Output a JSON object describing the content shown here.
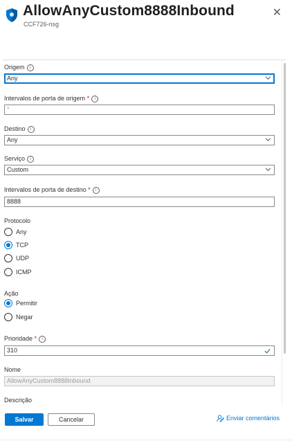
{
  "header": {
    "title": "AllowAnyCustom8888Inbound",
    "subtitle": "CCF726-nsg",
    "close_icon": "close-icon"
  },
  "form": {
    "origem": {
      "label": "Origem",
      "value": "Any"
    },
    "src_ports": {
      "label": "Intervalos de porta de origem",
      "required": "*",
      "value": "*"
    },
    "destino": {
      "label": "Destino",
      "value": "Any"
    },
    "servico": {
      "label": "Serviço",
      "value": "Custom"
    },
    "dst_ports": {
      "label": "Intervalos de porta de destino",
      "required": "*",
      "value": "8888"
    },
    "protocolo": {
      "label": "Protocolo",
      "options": [
        "Any",
        "TCP",
        "UDP",
        "ICMP"
      ],
      "selected": "TCP"
    },
    "acao": {
      "label": "Ação",
      "options": [
        "Permitir",
        "Negar"
      ],
      "selected": "Permitir"
    },
    "prioridade": {
      "label": "Prioridade",
      "required": "*",
      "value": "310"
    },
    "nome": {
      "label": "Nome",
      "value": "AllowAnyCustom8888Inbound"
    },
    "descricao": {
      "label": "Descrição"
    }
  },
  "footer": {
    "save_label": "Salvar",
    "cancel_label": "Cancelar",
    "feedback_label": "Enviar comentários"
  },
  "colors": {
    "accent": "#0078d4",
    "required": "#a4262c",
    "valid": "#107c10"
  }
}
